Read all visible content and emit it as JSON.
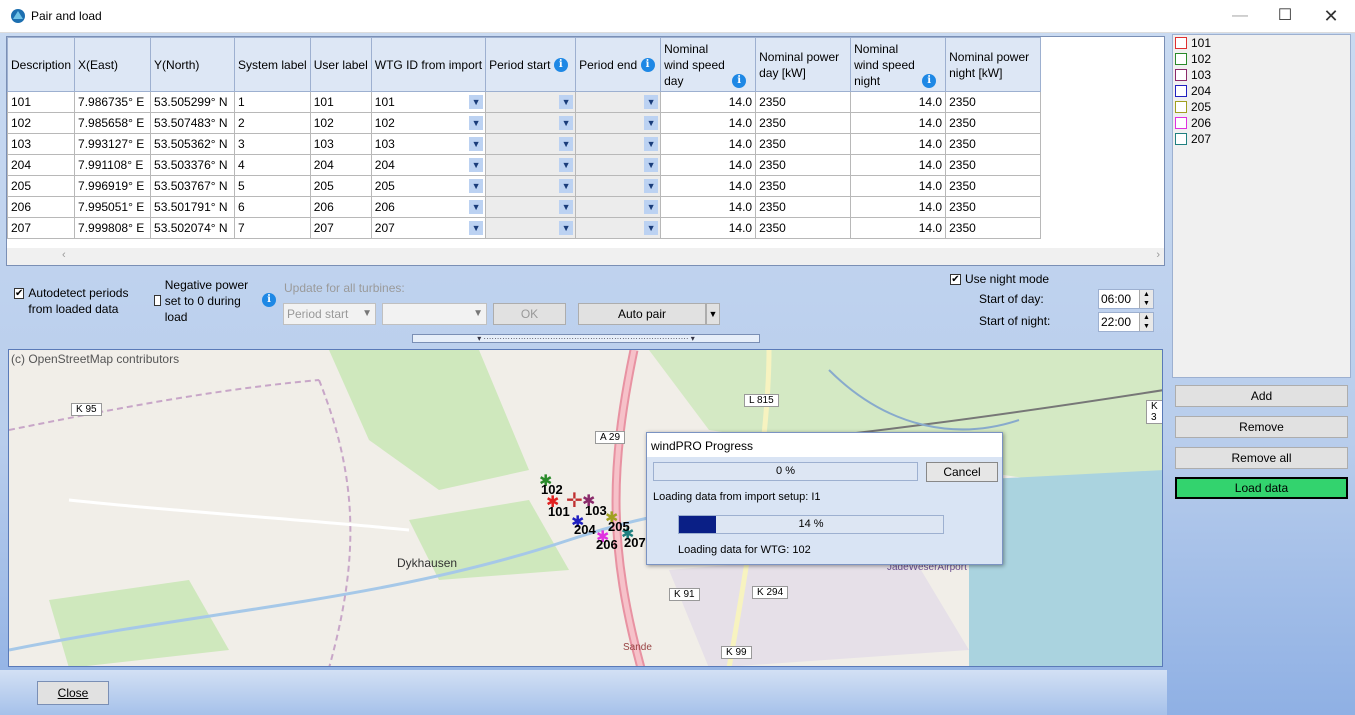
{
  "window": {
    "title": "Pair and load",
    "minimize": "—",
    "maximize": "☐",
    "close": "✕"
  },
  "columns": [
    "Description",
    "X(East)",
    "Y(North)",
    "System label",
    "User label",
    "WTG ID from import",
    "Period start",
    "Period end",
    "Nominal wind speed day",
    "Nominal power day [kW]",
    "Nominal wind speed night",
    "Nominal power night [kW]"
  ],
  "rows": [
    {
      "description": "101",
      "x": "7.986735° E",
      "y": "53.505299° N",
      "system": "1",
      "user": "101",
      "wtg": "101",
      "speed_day": "14.0",
      "power_day": "2350",
      "speed_night": "14.0",
      "power_night": "2350"
    },
    {
      "description": "102",
      "x": "7.985658° E",
      "y": "53.507483° N",
      "system": "2",
      "user": "102",
      "wtg": "102",
      "speed_day": "14.0",
      "power_day": "2350",
      "speed_night": "14.0",
      "power_night": "2350"
    },
    {
      "description": "103",
      "x": "7.993127° E",
      "y": "53.505362° N",
      "system": "3",
      "user": "103",
      "wtg": "103",
      "speed_day": "14.0",
      "power_day": "2350",
      "speed_night": "14.0",
      "power_night": "2350"
    },
    {
      "description": "204",
      "x": "7.991108° E",
      "y": "53.503376° N",
      "system": "4",
      "user": "204",
      "wtg": "204",
      "speed_day": "14.0",
      "power_day": "2350",
      "speed_night": "14.0",
      "power_night": "2350"
    },
    {
      "description": "205",
      "x": "7.996919° E",
      "y": "53.503767° N",
      "system": "5",
      "user": "205",
      "wtg": "205",
      "speed_day": "14.0",
      "power_day": "2350",
      "speed_night": "14.0",
      "power_night": "2350"
    },
    {
      "description": "206",
      "x": "7.995051° E",
      "y": "53.501791° N",
      "system": "6",
      "user": "206",
      "wtg": "206",
      "speed_day": "14.0",
      "power_day": "2350",
      "speed_night": "14.0",
      "power_night": "2350"
    },
    {
      "description": "207",
      "x": "7.999808° E",
      "y": "53.502074° N",
      "system": "7",
      "user": "207",
      "wtg": "207",
      "speed_day": "14.0",
      "power_day": "2350",
      "speed_night": "14.0",
      "power_night": "2350"
    }
  ],
  "sidebar": {
    "items": [
      {
        "label": "101",
        "color": "#e03030"
      },
      {
        "label": "102",
        "color": "#2a8a2a"
      },
      {
        "label": "103",
        "color": "#8a2a6a"
      },
      {
        "label": "204",
        "color": "#2020c0"
      },
      {
        "label": "205",
        "color": "#a0a020"
      },
      {
        "label": "206",
        "color": "#e030e0"
      },
      {
        "label": "207",
        "color": "#208080"
      }
    ],
    "add": "Add",
    "remove": "Remove",
    "remove_all": "Remove all",
    "load_data": "Load data"
  },
  "options": {
    "autodetect": "Autodetect periods from loaded data",
    "autodetect_checked": true,
    "negative": "Negative power set to 0 during load",
    "negative_checked": false,
    "update_all": "Update for all turbines:",
    "period_start": "Period start",
    "ok": "OK",
    "auto_pair": "Auto pair",
    "night_mode": "Use night mode",
    "night_mode_checked": true,
    "start_day_label": "Start of day:",
    "start_day": "06:00",
    "start_night_label": "Start of night:",
    "start_night": "22:00"
  },
  "map": {
    "attribution": "(c) OpenStreetMap contributors",
    "roads": [
      "K 95",
      "A 29",
      "L 815",
      "K 91",
      "K 294",
      "K 99",
      "K 3"
    ],
    "places": [
      "Dykhausen",
      "JadeWeserAirport",
      "Sande"
    ],
    "turbine_labels": [
      "102",
      "101",
      "103",
      "204",
      "205",
      "206",
      "207"
    ]
  },
  "progress": {
    "title": "windPRO Progress",
    "overall_text": "0 %",
    "overall": 0,
    "cancel": "Cancel",
    "status1": "Loading data from import setup: I1",
    "wtg_text": "14 %",
    "wtg": 0.14,
    "status2": "Loading data for WTG: 102"
  },
  "footer": {
    "close": "Close"
  }
}
